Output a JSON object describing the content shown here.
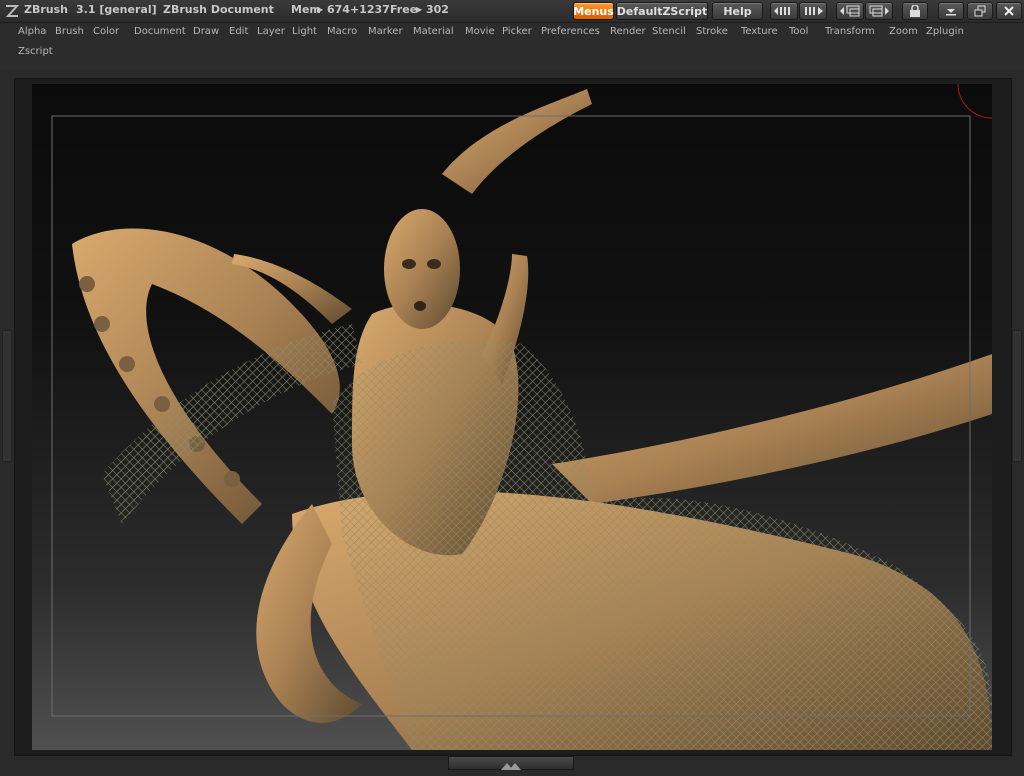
{
  "titlebar": {
    "app_name": "ZBrush",
    "version": "3.1 [general]",
    "document": "ZBrush Document",
    "mem_label": "Mem",
    "mem_value": "674+1237",
    "free_label": "Free",
    "free_value": "302",
    "menus_button": "Menus",
    "script_button": "DefaultZScript",
    "help_button": "Help",
    "accent_color": "#f07d10"
  },
  "menubar": {
    "items": [
      "Alpha",
      "Brush",
      "Color",
      "Document",
      "Draw",
      "Edit",
      "Layer",
      "Light",
      "Macro",
      "Marker",
      "Material",
      "Movie",
      "Picker",
      "Preferences",
      "Render",
      "Stencil",
      "Stroke",
      "Texture",
      "Tool",
      "Transform",
      "Zoom",
      "Zplugin",
      "Zscript"
    ]
  },
  "canvas": {
    "content": "sculpted-creature-render",
    "material_color": "#b08a58"
  }
}
